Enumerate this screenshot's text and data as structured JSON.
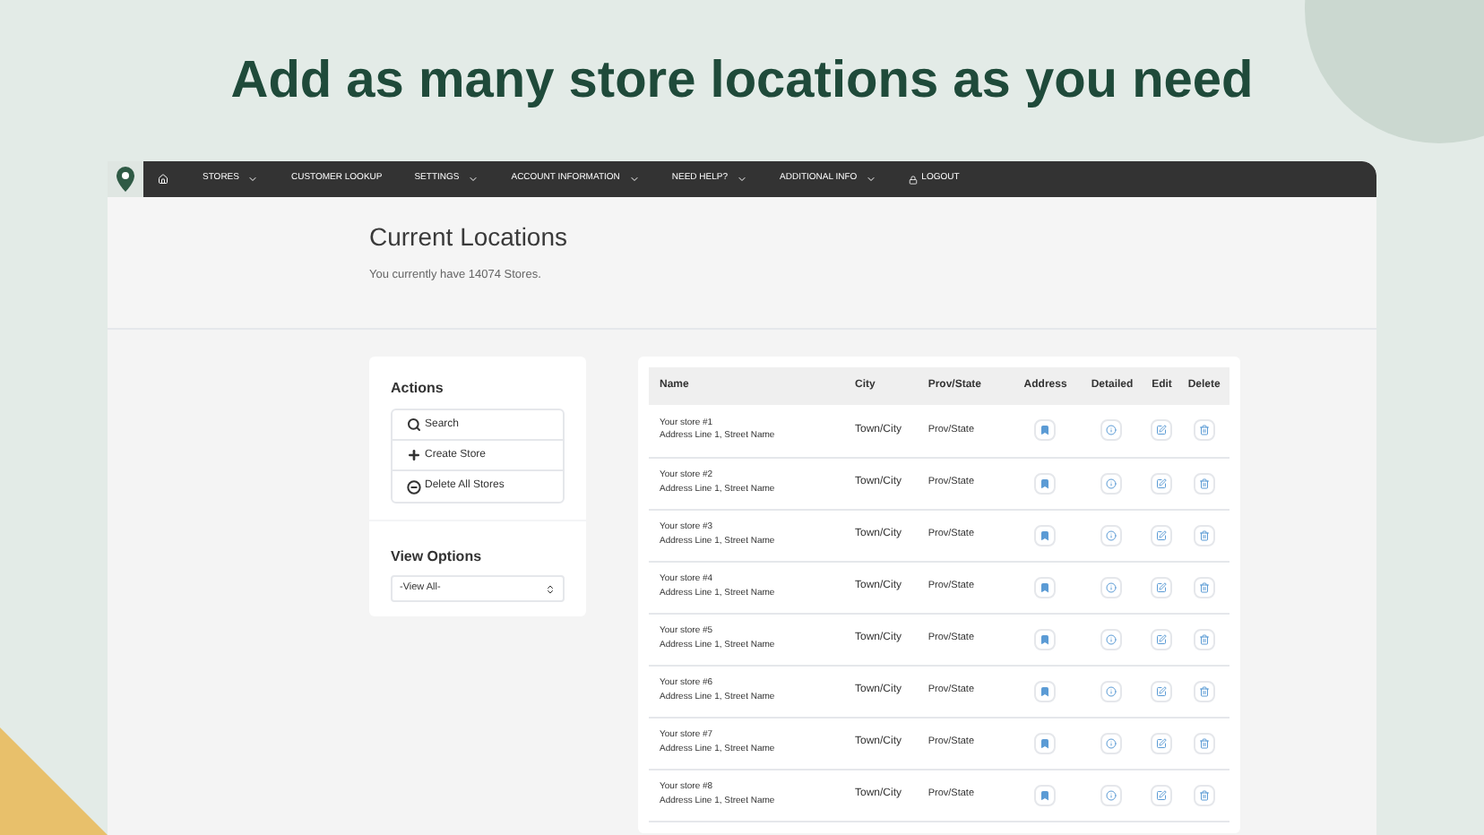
{
  "headline": "Add as many store locations as you need",
  "nav": [
    {
      "label": "STORES",
      "dropdown": true
    },
    {
      "label": "CUSTOMER LOOKUP",
      "dropdown": false
    },
    {
      "label": "SETTINGS",
      "dropdown": true
    },
    {
      "label": "ACCOUNT INFORMATION",
      "dropdown": true
    },
    {
      "label": "NEED HELP?",
      "dropdown": true
    },
    {
      "label": "ADDITIONAL INFO",
      "dropdown": true
    },
    {
      "label": "LOGOUT",
      "dropdown": false
    }
  ],
  "page": {
    "title": "Current Locations",
    "subtitle": "You currently have 14074 Stores."
  },
  "actions": {
    "title": "Actions",
    "items": [
      {
        "kind": "search",
        "label": "Search"
      },
      {
        "kind": "create",
        "label": "Create Store"
      },
      {
        "kind": "delete",
        "label": "Delete All Stores"
      }
    ]
  },
  "view_options": {
    "title": "View Options",
    "value": "-View All-"
  },
  "table": {
    "columns": [
      "Name",
      "City",
      "Prov/State",
      "Address",
      "Detailed",
      "Edit",
      "Delete"
    ],
    "rows": [
      {
        "name": "Your store #1",
        "address": "Address Line 1, Street Name",
        "city": "Town/City",
        "prov": "Prov/State"
      },
      {
        "name": "Your store #2",
        "address": "Address Line 1, Street Name",
        "city": "Town/City",
        "prov": "Prov/State"
      },
      {
        "name": "Your store #3",
        "address": "Address Line 1, Street Name",
        "city": "Town/City",
        "prov": "Prov/State"
      },
      {
        "name": "Your store #4",
        "address": "Address Line 1, Street Name",
        "city": "Town/City",
        "prov": "Prov/State"
      },
      {
        "name": "Your store #5",
        "address": "Address Line 1, Street Name",
        "city": "Town/City",
        "prov": "Prov/State"
      },
      {
        "name": "Your store #6",
        "address": "Address Line 1, Street Name",
        "city": "Town/City",
        "prov": "Prov/State"
      },
      {
        "name": "Your store #7",
        "address": "Address Line 1, Street Name",
        "city": "Town/City",
        "prov": "Prov/State"
      },
      {
        "name": "Your store #8",
        "address": "Address Line 1, Street Name",
        "city": "Town/City",
        "prov": "Prov/State"
      }
    ]
  }
}
